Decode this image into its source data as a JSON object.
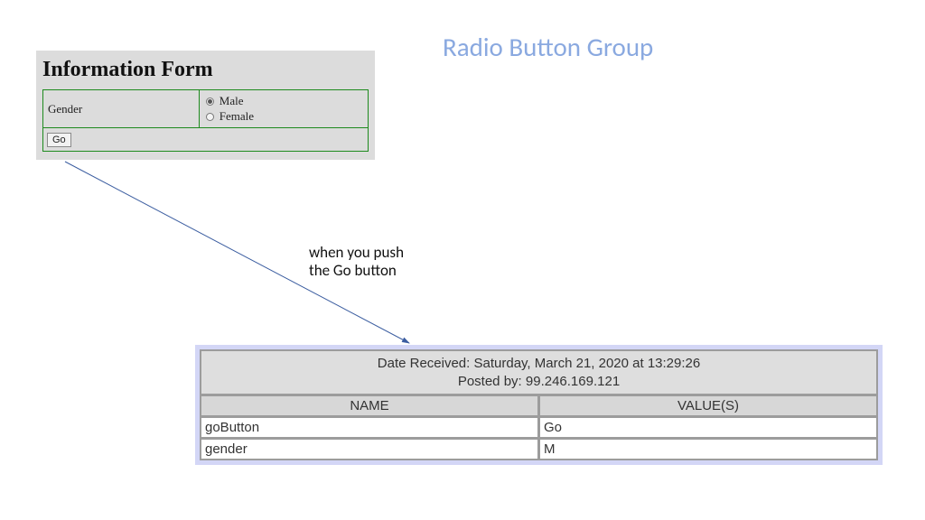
{
  "slide": {
    "title": "Radio Button Group",
    "annotation_line1": "when you push",
    "annotation_line2": "the Go button"
  },
  "form": {
    "heading": "Information Form",
    "field_label": "Gender",
    "options": {
      "male": "Male",
      "female": "Female"
    },
    "selected": "male",
    "go_label": "Go"
  },
  "result": {
    "date_label": "Date Received:",
    "date_value": "Saturday, March 21, 2020 at 13:29:26",
    "posted_label": "Posted by:",
    "posted_value": "99.246.169.121",
    "header_name": "NAME",
    "header_value": "VALUE(S)",
    "rows": [
      {
        "name": "goButton",
        "value": "Go"
      },
      {
        "name": "gender",
        "value": "M"
      }
    ]
  }
}
